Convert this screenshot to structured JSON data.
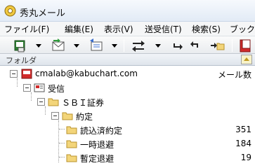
{
  "window": {
    "title": "秀丸メール",
    "icon": "hidemaru-mail-app-icon"
  },
  "menu": [
    {
      "label": "ファイル(F)"
    },
    {
      "label": "編集(E)"
    },
    {
      "label": "表示(V)"
    },
    {
      "label": "送受信(T)"
    },
    {
      "label": "検索(S)"
    },
    {
      "label": "ブック"
    }
  ],
  "toolbar": {
    "icons": [
      "receive-mail-icon",
      "dropdown-arrow-icon",
      "compose-mail-icon",
      "dropdown-arrow-icon",
      "reply-mail-icon",
      "dropdown-arrow-icon",
      "send-receive-icon",
      "dropdown-arrow-icon",
      "move-down-icon",
      "move-up-icon",
      "forward-folder-icon",
      "address-book-icon"
    ]
  },
  "folder_pane": {
    "label": "フォルダ"
  },
  "tree": {
    "account": {
      "label": "cmalab@kabuchart.com",
      "count_header": "メール数"
    },
    "items": [
      {
        "label": "受信",
        "count": ""
      },
      {
        "label": "ＳＢＩ証券",
        "count": ""
      },
      {
        "label": "約定",
        "count": ""
      },
      {
        "label": "読込済約定",
        "count": "351"
      },
      {
        "label": "一時退避",
        "count": "184"
      },
      {
        "label": "暫定退避",
        "count": "19"
      }
    ]
  },
  "colors": {
    "folder_yellow": "#f3d57a",
    "account_red": "#d12b2b",
    "titlebar": "#e2ebf6"
  }
}
